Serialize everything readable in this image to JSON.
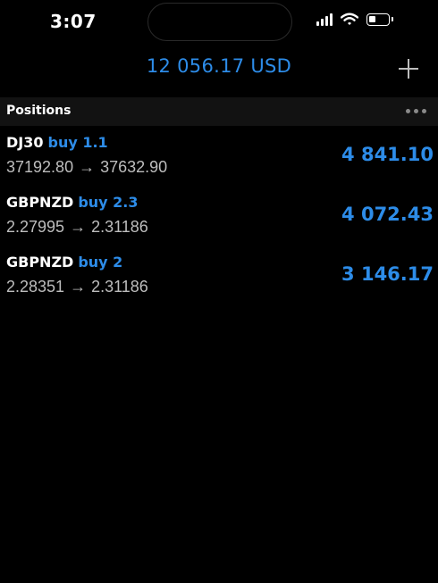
{
  "status_bar": {
    "time": "3:07"
  },
  "header": {
    "balance": "12 056.17 USD",
    "add_icon": "plus-icon"
  },
  "positions_section": {
    "title": "Positions",
    "more_icon": "more-horizontal-icon"
  },
  "positions": [
    {
      "symbol": "DJ30",
      "type": "buy 1.1",
      "open_price": "37192.80",
      "arrow": "→",
      "current_price": "37632.90",
      "profit": "4 841.10"
    },
    {
      "symbol": "GBPNZD",
      "type": "buy 2.3",
      "open_price": "2.27995",
      "arrow": "→",
      "current_price": "2.31186",
      "profit": "4 072.43"
    },
    {
      "symbol": "GBPNZD",
      "type": "buy 2",
      "open_price": "2.28351",
      "arrow": "→",
      "current_price": "2.31186",
      "profit": "3 146.17"
    }
  ],
  "colors": {
    "accent": "#2d8ce8",
    "background": "#000000",
    "section_background": "#121212",
    "secondary_text": "#bdbdbd"
  }
}
